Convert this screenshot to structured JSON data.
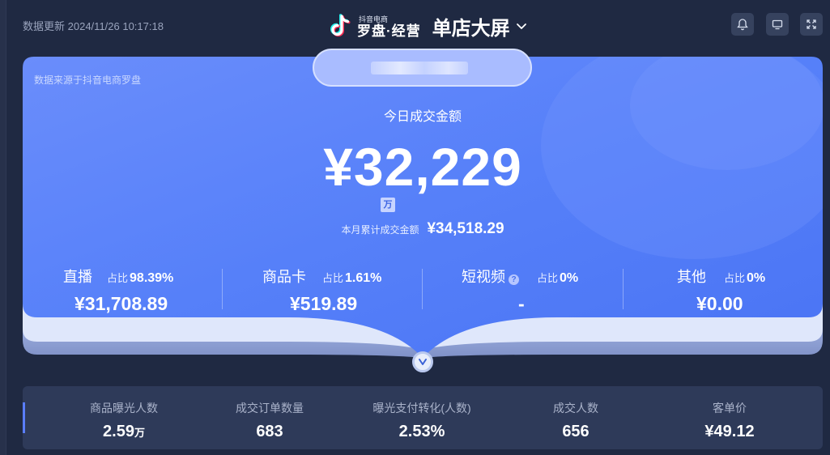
{
  "header": {
    "update_label": "数据更新",
    "update_time": "2024/11/26 10:17:18",
    "brand_small": "抖音电商",
    "brand_main": "罗盘·经营",
    "screen_title": "单店大屏",
    "icons": [
      "bell-icon",
      "monitor-icon",
      "fullscreen-icon",
      "chevron-down-icon",
      "douyin-logo-icon"
    ]
  },
  "hero": {
    "source_note": "数据来源于抖音电商罗盘",
    "today_label": "今日成交金额",
    "today_amount": "¥32,229",
    "unit_tag": "万",
    "month_label": "本月累计成交金额",
    "month_value": "¥34,518.29",
    "ratio_label": "占比",
    "channels": [
      {
        "name": "直播",
        "ratio": "98.39%",
        "value": "¥31,708.89"
      },
      {
        "name": "商品卡",
        "ratio": "1.61%",
        "value": "¥519.89"
      },
      {
        "name": "短视频",
        "ratio": "0%",
        "value": "-",
        "help": "?"
      },
      {
        "name": "其他",
        "ratio": "0%",
        "value": "¥0.00"
      }
    ]
  },
  "metrics": [
    {
      "label": "商品曝光人数",
      "value": "2.59",
      "unit": "万"
    },
    {
      "label": "成交订单数量",
      "value": "683",
      "unit": ""
    },
    {
      "label": "曝光支付转化(人数)",
      "value": "2.53%",
      "unit": ""
    },
    {
      "label": "成交人数",
      "value": "656",
      "unit": ""
    },
    {
      "label": "客单价",
      "value": "¥49.12",
      "unit": ""
    }
  ],
  "colors": {
    "background": "#1f2942",
    "hero_blue": "#4f7af8",
    "metrics_panel": "#2e3a59",
    "accent": "#5a7dff"
  }
}
